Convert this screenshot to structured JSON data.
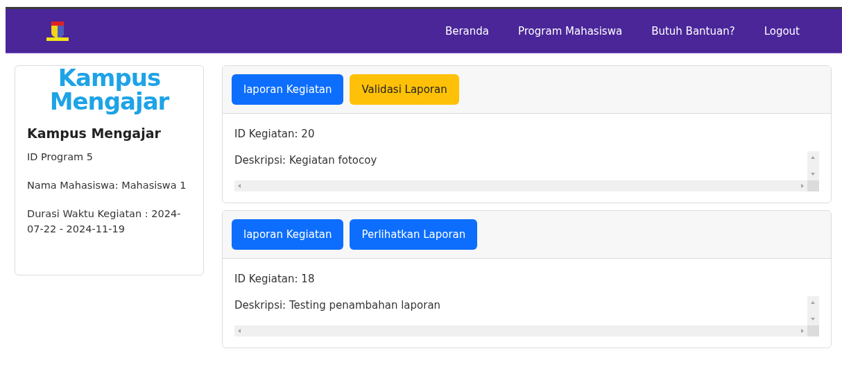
{
  "navbar": {
    "links": [
      {
        "label": "Beranda"
      },
      {
        "label": "Program Mahasiswa"
      },
      {
        "label": "Butuh Bantuan?"
      },
      {
        "label": "Logout"
      }
    ]
  },
  "sidebar": {
    "logo": {
      "line_1": "Kampus",
      "line_2": "Mengajar"
    },
    "title": "Kampus Mengajar",
    "program_id": "ID Program 5",
    "student": "Nama Mahasiswa: Mahasiswa 1",
    "duration": "Durasi Waktu Kegiatan : 2024-07-22 - 2024-11-19"
  },
  "activities": [
    {
      "buttons": [
        {
          "label": "laporan Kegiatan",
          "kind": "primary"
        },
        {
          "label": "Validasi Laporan",
          "kind": "warning"
        }
      ],
      "id_text": "ID Kegiatan: 20",
      "description": "Deskripsi: Kegiatan fotocoy"
    },
    {
      "buttons": [
        {
          "label": "laporan Kegiatan",
          "kind": "primary"
        },
        {
          "label": "Perlihatkan Laporan",
          "kind": "primary"
        }
      ],
      "id_text": "ID Kegiatan: 18",
      "description": "Deskripsi: Testing penambahan laporan"
    }
  ]
}
